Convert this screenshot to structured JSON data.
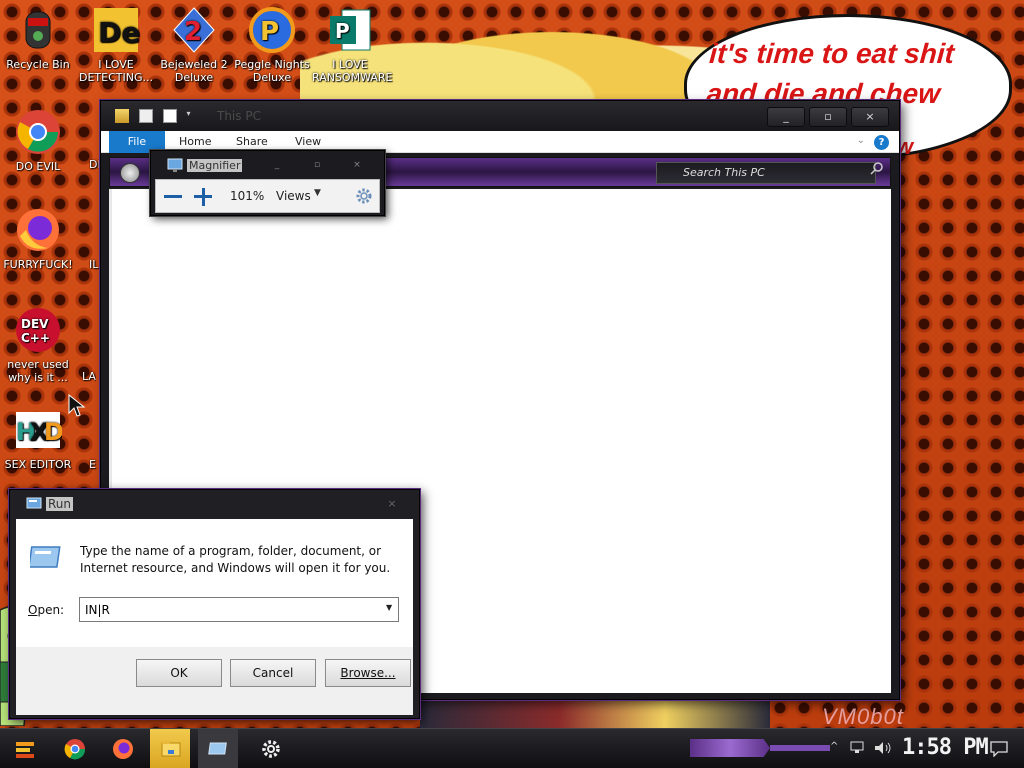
{
  "wallpaper": {
    "speech_bubble": "it's time to eat shit and die and chew",
    "bubble_partial": "w",
    "watermark": "VM0b0t"
  },
  "desktop_icons": [
    {
      "name": "recycle-bin-icon",
      "label": "Recycle Bin"
    },
    {
      "name": "i-love-detecting-icon",
      "label": "I LOVE DETECTING..."
    },
    {
      "name": "bejeweled-icon",
      "label": "Bejeweled 2 Deluxe"
    },
    {
      "name": "peggle-icon",
      "label": "Peggle Nights Deluxe"
    },
    {
      "name": "publisher-icon",
      "label": "I LOVE RANSOMWARE"
    },
    {
      "name": "chrome-icon",
      "label": "DO EVIL"
    },
    {
      "name": "firefox-icon",
      "label": "FURRYFUCK!"
    },
    {
      "name": "devcpp-icon",
      "label": "never used why is it ..."
    },
    {
      "name": "hxd-icon",
      "label": "SEX EDITOR"
    }
  ],
  "partial_labels": [
    "DE HA",
    "IL",
    "LAN",
    "E SI"
  ],
  "explorer": {
    "title": "This PC",
    "tabs": [
      "File",
      "Home",
      "Share",
      "View"
    ],
    "search_placeholder": "Search This PC",
    "help": "?",
    "buttons": {
      "minimize": "_",
      "maximize": "▫",
      "close": "×"
    }
  },
  "magnifier": {
    "title": "Magnifier",
    "zoom": "101%",
    "views_label": "Views",
    "views_arrow": "▼"
  },
  "run_dialog": {
    "title": "Run",
    "description": "Type the name of a program, folder, document, or Internet resource, and Windows will open it for you.",
    "open_label_prefix": "",
    "open_label_accel": "O",
    "open_label_rest": "pen:",
    "open_value": "IN|R",
    "combo_arrow": "▼",
    "buttons": {
      "ok": "OK",
      "cancel": "Cancel",
      "browse": "Browse..."
    }
  },
  "taskbar": {
    "clock": "1:58 PM",
    "tray_chevron": "^"
  },
  "colors": {
    "accent_blue": "#1979ca",
    "theme_purple": "#5b2f87",
    "bubble_red": "#d91515"
  }
}
